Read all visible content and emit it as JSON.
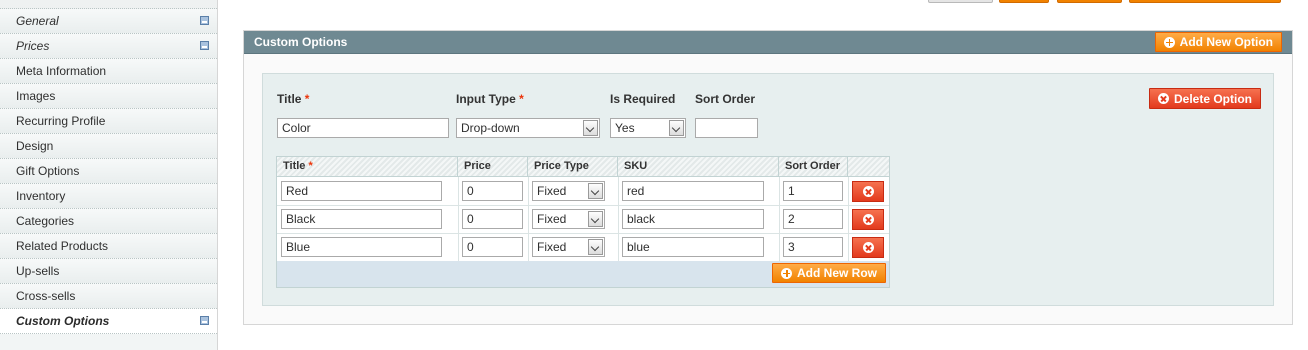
{
  "sidebar": {
    "items": [
      {
        "label": "General",
        "italic": true,
        "icon": "disk-icon"
      },
      {
        "label": "Prices",
        "italic": true,
        "icon": "disk-icon"
      },
      {
        "label": "Meta Information"
      },
      {
        "label": "Images"
      },
      {
        "label": "Recurring Profile"
      },
      {
        "label": "Design"
      },
      {
        "label": "Gift Options"
      },
      {
        "label": "Inventory"
      },
      {
        "label": "Categories"
      },
      {
        "label": "Related Products"
      },
      {
        "label": "Up-sells"
      },
      {
        "label": "Cross-sells"
      },
      {
        "label": "Custom Options",
        "active": true,
        "icon": "disk-icon"
      }
    ]
  },
  "section": {
    "title": "Custom Options",
    "add_option_label": "Add New Option"
  },
  "option": {
    "title_label": "Title",
    "title_value": "Color",
    "input_type_label": "Input Type",
    "input_type_value": "Drop-down",
    "is_required_label": "Is Required",
    "is_required_value": "Yes",
    "sort_order_label": "Sort Order",
    "sort_order_value": "",
    "delete_label": "Delete Option",
    "required_marker": "*"
  },
  "values_grid": {
    "headers": {
      "title": "Title",
      "price": "Price",
      "price_type": "Price Type",
      "sku": "SKU",
      "sort_order": "Sort Order"
    },
    "rows": [
      {
        "title": "Red",
        "price": "0",
        "price_type": "Fixed",
        "sku": "red",
        "sort_order": "1"
      },
      {
        "title": "Black",
        "price": "0",
        "price_type": "Fixed",
        "sku": "black",
        "sort_order": "2"
      },
      {
        "title": "Blue",
        "price": "0",
        "price_type": "Fixed",
        "sku": "blue",
        "sort_order": "3"
      }
    ],
    "add_row_label": "Add New Row"
  },
  "colors": {
    "accent_orange": "#f18200",
    "delete_red": "#e33a1d",
    "section_header": "#6f8992"
  }
}
